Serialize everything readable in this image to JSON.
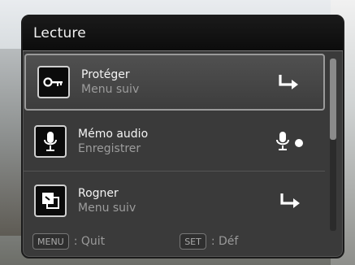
{
  "header": {
    "title": "Lecture"
  },
  "menu": {
    "items": [
      {
        "title": "Protéger",
        "subtitle": "Menu suiv",
        "icon": "key-icon",
        "right_icon": "arrow-turn-right-icon"
      },
      {
        "title": "Mémo audio",
        "subtitle": "Enregistrer",
        "icon": "microphone-icon",
        "right_icon": "mic-record-icon"
      },
      {
        "title": "Rogner",
        "subtitle": "Menu suiv",
        "icon": "crop-icon",
        "right_icon": "arrow-turn-right-icon"
      }
    ]
  },
  "footer": {
    "menu_key": "MENU",
    "menu_action": ": Quit",
    "set_key": "SET",
    "set_action": ": Déf"
  }
}
